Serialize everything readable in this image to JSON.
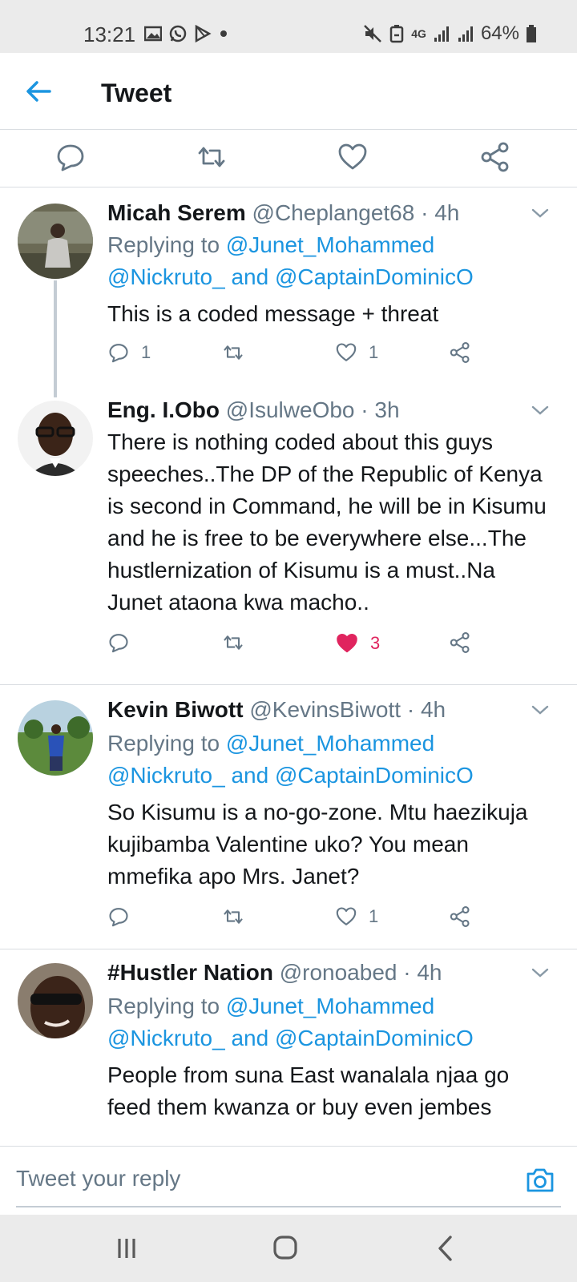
{
  "status_bar": {
    "time": "13:21",
    "network": "4G",
    "battery": "64%",
    "left_icons": [
      "image-icon",
      "whatsapp-icon",
      "play-store-icon",
      "dot-icon"
    ],
    "right_icons": [
      "mute-icon",
      "battery-saver-icon",
      "signal-icon",
      "signal-icon",
      "battery-icon"
    ]
  },
  "app_bar": {
    "title": "Tweet"
  },
  "colors": {
    "accent": "#1b95e0",
    "like": "#e0245e",
    "muted": "#657786",
    "text": "#14171a"
  },
  "tweets": [
    {
      "name": "Micah Serem",
      "meta": "@Cheplanget68 · 4h",
      "replying_prefix": "Replying to ",
      "replying_to_1": "@Junet_Mohammed",
      "replying_to_2": "@Nickruto_ and @CaptainDominicO",
      "body": "This is a coded message + threat",
      "reply_count": "1",
      "retweet_count": "",
      "like_count": "1",
      "liked": false
    },
    {
      "name": "Eng. I.Obo",
      "meta": "@IsulweObo · 3h",
      "body": "There is nothing coded about this guys speeches..The DP of the Republic of Kenya is second in Command, he will be in Kisumu and he is free to be everywhere else...The hustlernization of Kisumu is a must..Na Junet ataona kwa macho..",
      "reply_count": "",
      "retweet_count": "",
      "like_count": "3",
      "liked": true
    },
    {
      "name": "Kevin Biwott",
      "meta": "@KevinsBiwott · 4h",
      "replying_prefix": "Replying to ",
      "replying_to_1": "@Junet_Mohammed",
      "replying_to_2": "@Nickruto_ and @CaptainDominicO",
      "body": "So Kisumu is a no-go-zone. Mtu haezikuja kujibamba Valentine uko? You mean mmefika apo Mrs. Janet?",
      "reply_count": "",
      "retweet_count": "",
      "like_count": "1",
      "liked": false
    },
    {
      "name": "#Hustler Nation",
      "meta": "@ronoabed · 4h",
      "replying_prefix": "Replying to ",
      "replying_to_1": "@Junet_Mohammed",
      "replying_to_2": "@Nickruto_ and @CaptainDominicO",
      "body": "People from suna East wanalala njaa go feed them kwanza or buy even jembes"
    }
  ],
  "reply_box": {
    "placeholder": "Tweet your reply"
  },
  "nav_bar": {
    "buttons": [
      "recents-icon",
      "home-icon",
      "back-icon"
    ]
  }
}
